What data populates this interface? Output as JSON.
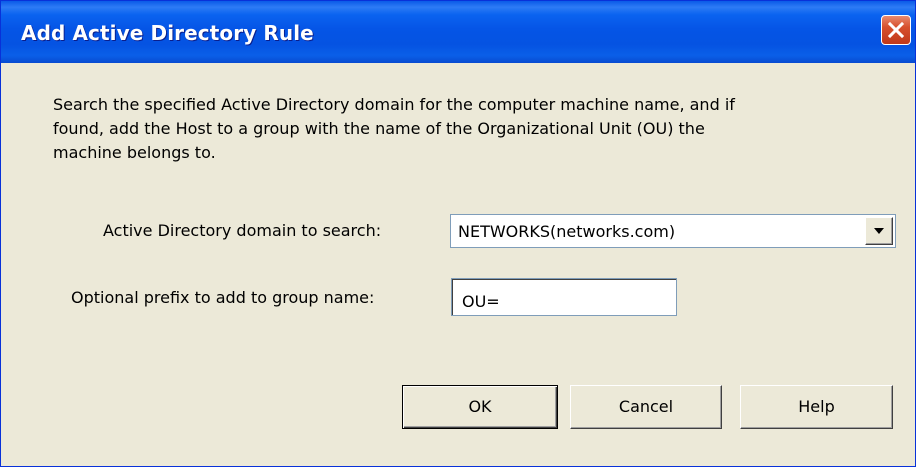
{
  "window": {
    "title": "Add Active Directory Rule"
  },
  "description": {
    "line1": "Search the specified Active Directory domain for the computer machine name, and if",
    "line2": "found, add the Host to a group with the name of the Organizational Unit (OU) the",
    "line3": "machine belongs to."
  },
  "domain_field": {
    "label": "Active Directory domain to search:",
    "selected_value": "NETWORKS(networks.com)"
  },
  "prefix_field": {
    "label": "Optional prefix to add to group name:",
    "value": "OU="
  },
  "buttons": {
    "ok": "OK",
    "cancel": "Cancel",
    "help": "Help"
  },
  "icons": {
    "close": "close-icon",
    "dropdown": "chevron-down-icon"
  },
  "colors": {
    "title_bar": "#0555e6",
    "dialog_background": "#ece9d8",
    "close_button": "#d7502d"
  }
}
